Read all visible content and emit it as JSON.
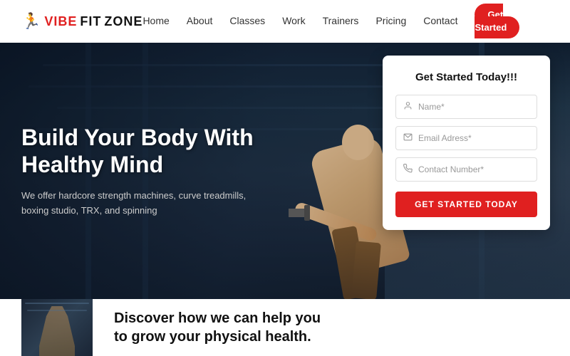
{
  "navbar": {
    "logo": {
      "icon": "🏃",
      "text_vibe": "VIBE",
      "text_fit": "FIT",
      "text_zone": "ZONE"
    },
    "links": [
      {
        "label": "Home",
        "id": "home"
      },
      {
        "label": "About",
        "id": "about"
      },
      {
        "label": "Classes",
        "id": "classes"
      },
      {
        "label": "Work",
        "id": "work"
      },
      {
        "label": "Trainers",
        "id": "trainers"
      },
      {
        "label": "Pricing",
        "id": "pricing"
      },
      {
        "label": "Contact",
        "id": "contact"
      }
    ],
    "cta_label": "Get Started"
  },
  "hero": {
    "title": "Build Your Body With Healthy Mind",
    "subtitle": "We offer hardcore strength machines, curve treadmills, boxing studio, TRX, and spinning"
  },
  "form": {
    "title": "Get Started Today!!!",
    "name_placeholder": "Name*",
    "email_placeholder": "Email Adress*",
    "phone_placeholder": "Contact Number*",
    "submit_label": "GET STARTED TODAY"
  },
  "below_hero": {
    "text": "Discover how we can help you\nto grow your physical health."
  }
}
